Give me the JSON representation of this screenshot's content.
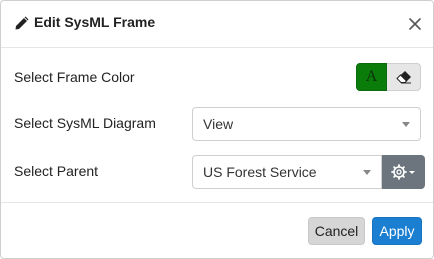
{
  "dialog": {
    "title": "Edit SysML Frame",
    "title_icon": "pencil-icon",
    "close_icon": "close-icon"
  },
  "frame_color": {
    "label": "Select Frame Color",
    "text_color_button_label": "A",
    "text_color_button_bg": "#0a7c0a",
    "eraser_icon": "eraser-icon"
  },
  "diagram": {
    "label": "Select SysML Diagram",
    "selected": "View"
  },
  "parent": {
    "label": "Select Parent",
    "selected": "US Forest Service",
    "options_icon": "gear-icon"
  },
  "footer": {
    "cancel_label": "Cancel",
    "apply_label": "Apply"
  },
  "colors": {
    "primary": "#1a7fd1",
    "secondary": "#6c757d",
    "green": "#0a7c0a"
  }
}
